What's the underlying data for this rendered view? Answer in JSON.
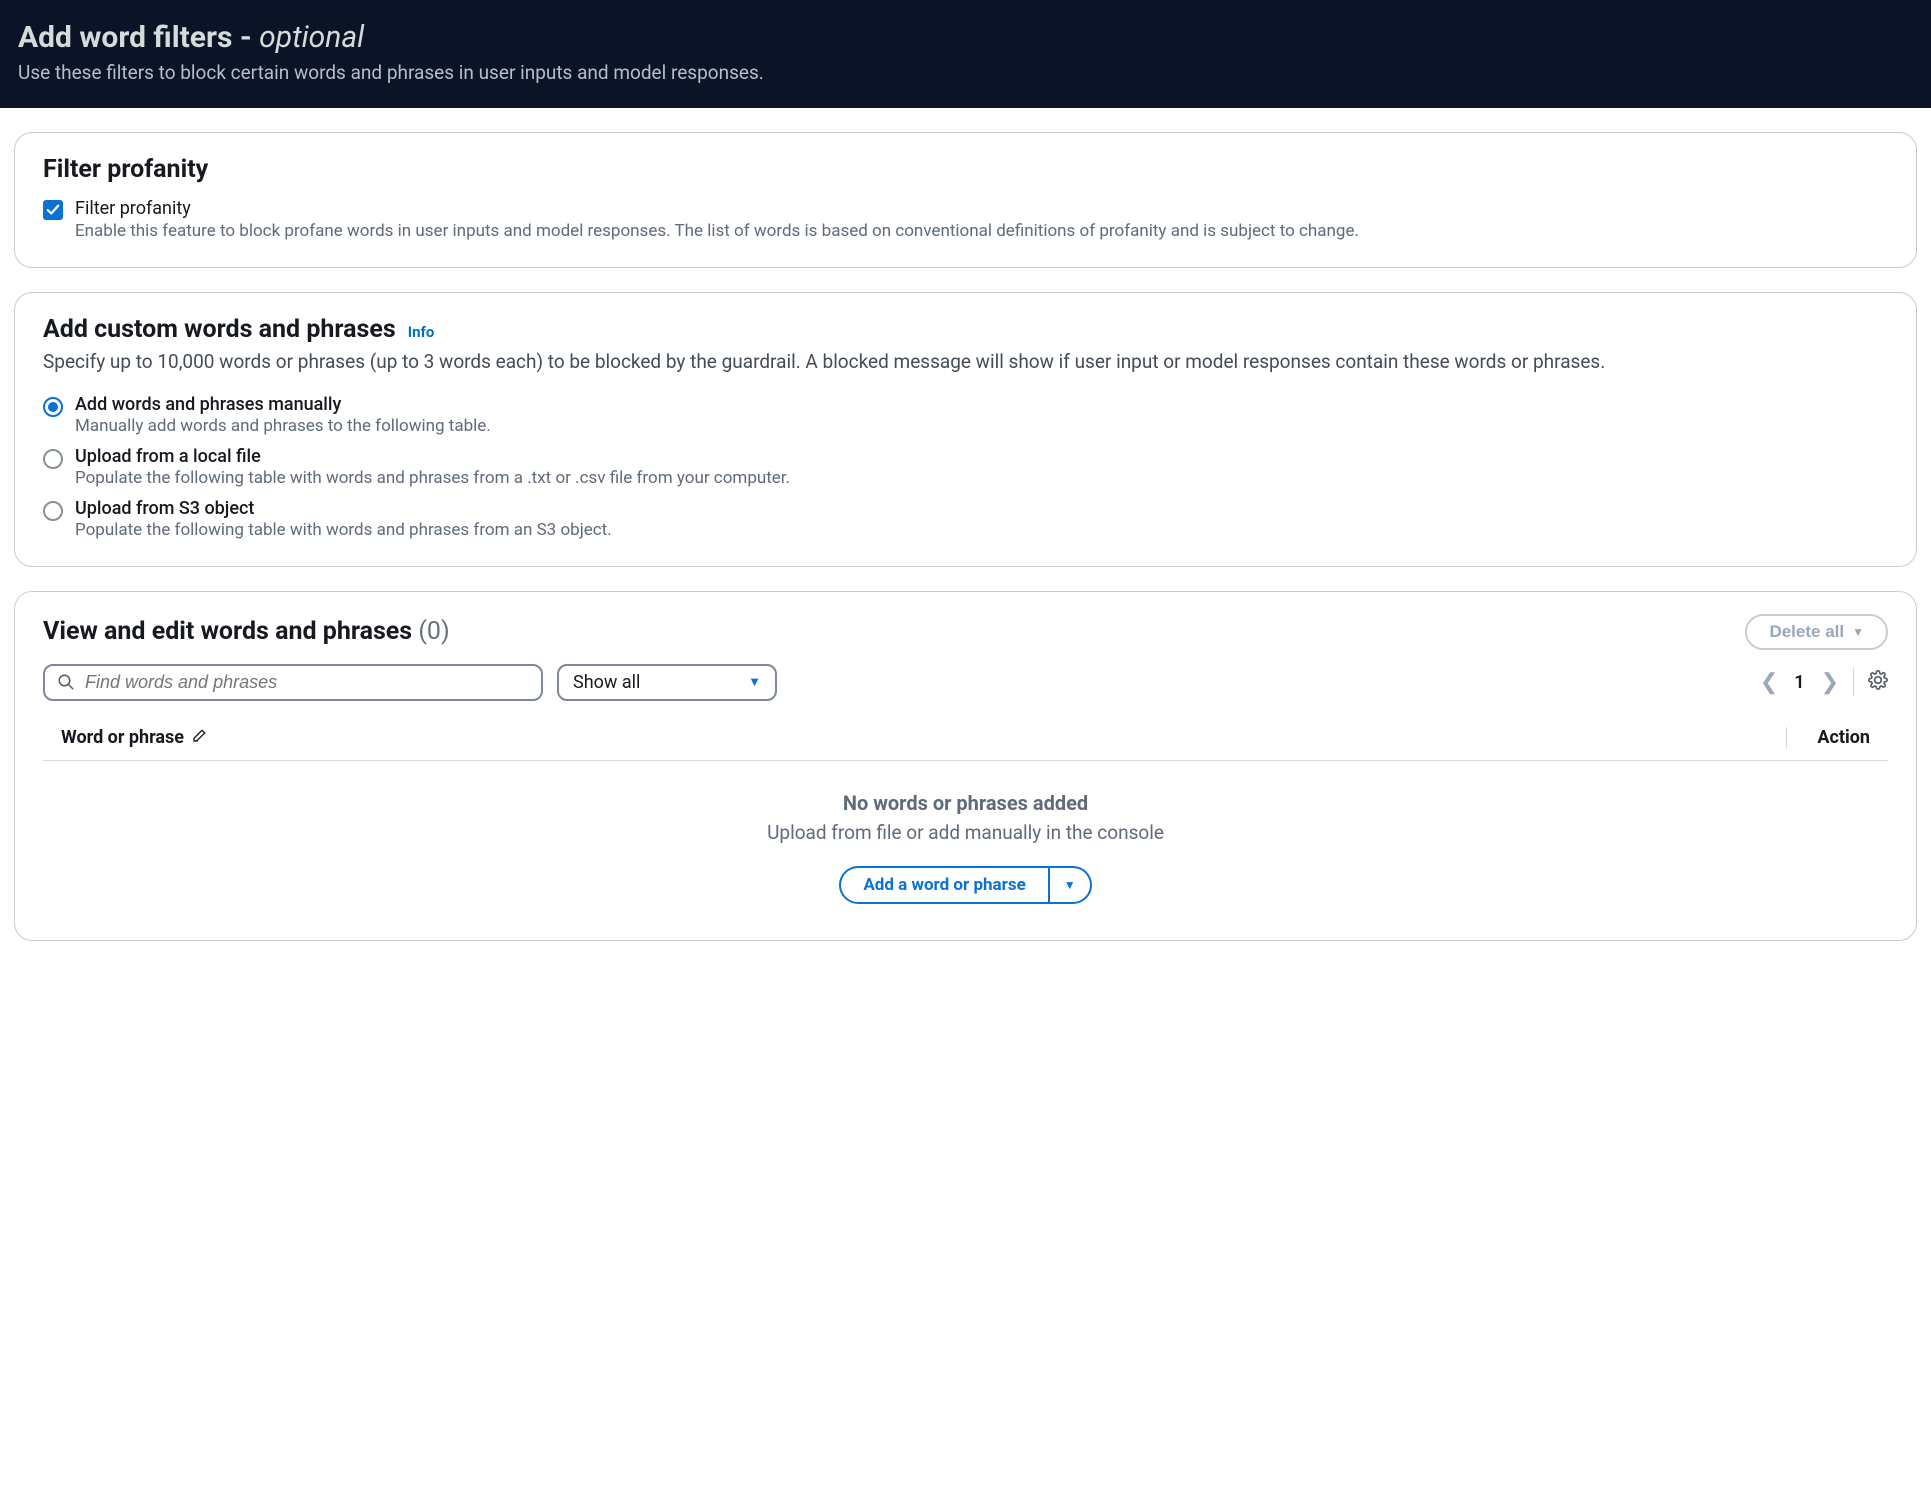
{
  "header": {
    "title_main": "Add word filters - ",
    "title_optional": "optional",
    "subtitle": "Use these filters to block certain words and phrases in user inputs and model responses."
  },
  "profanity_panel": {
    "title": "Filter profanity",
    "checkbox_label": "Filter profanity",
    "checkbox_desc": "Enable this feature to block profane words in user inputs and model responses. The list of words is based on conventional definitions of profanity and is subject to change."
  },
  "custom_panel": {
    "title": "Add custom words and phrases",
    "info_link": "Info",
    "desc": "Specify up to 10,000 words or phrases (up to 3 words each) to be blocked by the guardrail. A blocked message will show if user input or model responses contain these words or phrases.",
    "options": [
      {
        "label": "Add words and phrases manually",
        "desc": "Manually add words and phrases to the following table.",
        "selected": true
      },
      {
        "label": "Upload from a local file",
        "desc": "Populate the following table with words and phrases from a .txt or .csv file from your computer.",
        "selected": false
      },
      {
        "label": "Upload from S3 object",
        "desc": "Populate the following table with words and phrases from an S3 object.",
        "selected": false
      }
    ]
  },
  "view_panel": {
    "title": "View and edit words and phrases",
    "count_display": "(0)",
    "delete_all": "Delete all",
    "search_placeholder": "Find words and phrases",
    "select_value": "Show all",
    "page_number": "1",
    "col_word": "Word or phrase",
    "col_action": "Action",
    "empty_title": "No words or phrases added",
    "empty_sub": "Upload from file or add manually in the console",
    "add_button": "Add a word or pharse"
  }
}
